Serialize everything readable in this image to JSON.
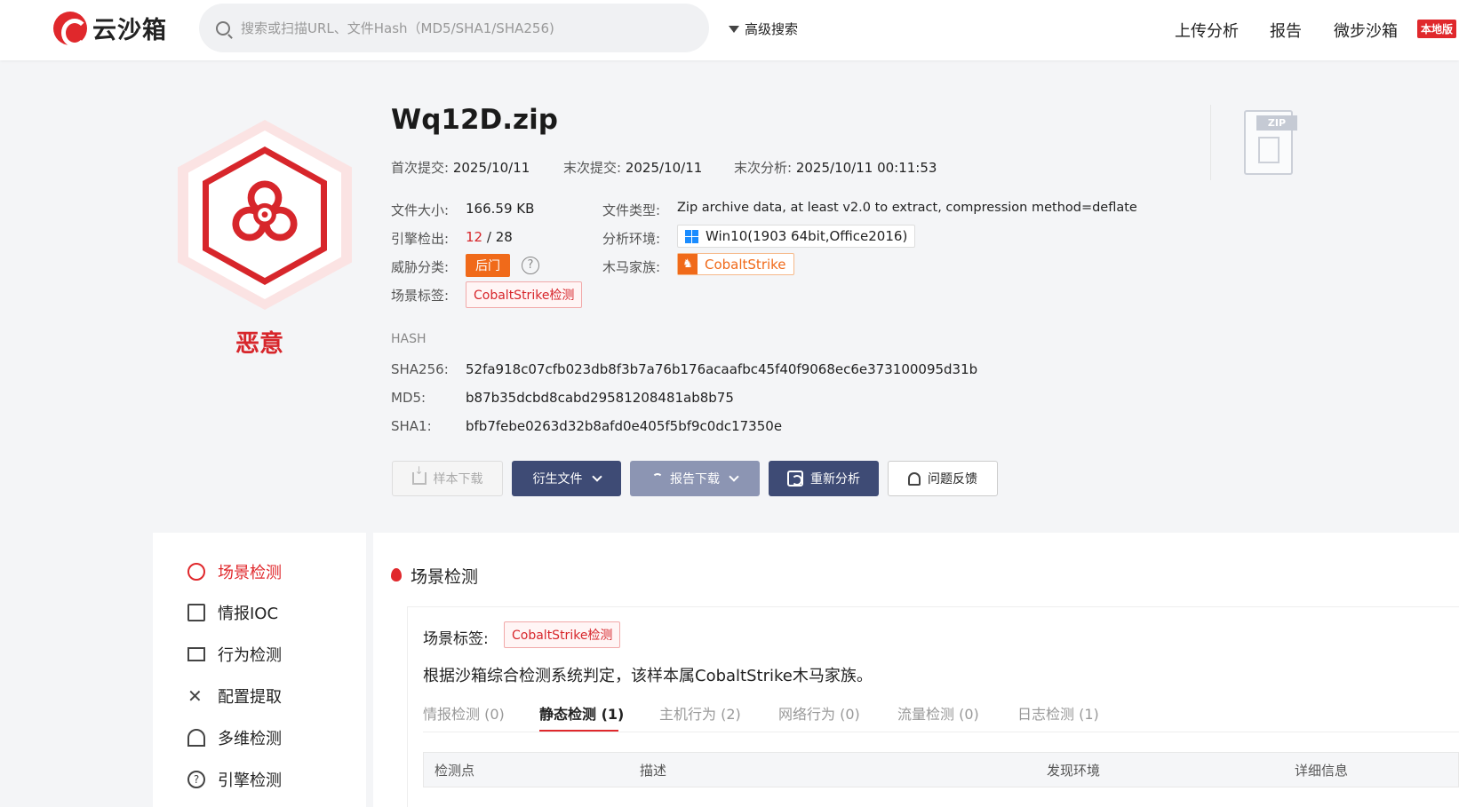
{
  "header": {
    "logo_text": "云沙箱",
    "search_placeholder": "搜索或扫描URL、文件Hash（MD5/SHA1/SHA256)",
    "advanced_search": "高级搜索",
    "nav": [
      "上传分析",
      "报告",
      "微步沙箱"
    ],
    "local_badge": "本地版"
  },
  "verdict": "恶意",
  "file": {
    "name": "Wq12D.zip",
    "first_submit_label": "首次提交:",
    "first_submit": "2025/10/11",
    "last_submit_label": "末次提交:",
    "last_submit": "2025/10/11",
    "last_analysis_label": "末次分析:",
    "last_analysis": "2025/10/11 00:11:53",
    "size_label": "文件大小:",
    "size": "166.59 KB",
    "type_label": "文件类型:",
    "type": "Zip archive data, at least v2.0 to extract, compression method=deflate",
    "engine_label": "引擎检出:",
    "engine_hits": "12",
    "engine_total": "/ 28",
    "env_label": "分析环境:",
    "env": "Win10(1903 64bit,Office2016)",
    "threat_label": "威胁分类:",
    "threat": "后门",
    "family_label": "木马家族:",
    "family": "CobaltStrike",
    "scene_label": "场景标签:",
    "scene_tag": "CobaltStrike检测",
    "zip_icon_label": "ZIP"
  },
  "hash": {
    "heading": "HASH",
    "sha256_label": "SHA256:",
    "sha256": "52fa918c07cfb023db8f3b7a76b176acaafbc45f40f9068ec6e373100095d31b",
    "md5_label": "MD5:",
    "md5": "b87b35dcbd8cabd29581208481ab8b75",
    "sha1_label": "SHA1:",
    "sha1": "bfb7febe0263d32b8afd0e405f5bf9c0dc17350e"
  },
  "actions": {
    "sample_download": "样本下载",
    "derived_files": "衍生文件",
    "report_download": "报告下载",
    "reanalyze": "重新分析",
    "feedback": "问题反馈"
  },
  "sidebar": {
    "items": [
      "场景检测",
      "情报IOC",
      "行为检测",
      "配置提取",
      "多维检测",
      "引擎检测"
    ]
  },
  "scene_section": {
    "title": "场景检测",
    "tag_label": "场景标签:",
    "tag": "CobaltStrike检测",
    "description": "根据沙箱综合检测系统判定，该样本属CobaltStrike木马家族。",
    "tabs": [
      "情报检测 (0)",
      "静态检测 (1)",
      "主机行为 (2)",
      "网络行为 (0)",
      "流量检测 (0)",
      "日志检测 (1)"
    ],
    "columns": [
      "检测点",
      "描述",
      "发现环境",
      "详细信息"
    ]
  }
}
